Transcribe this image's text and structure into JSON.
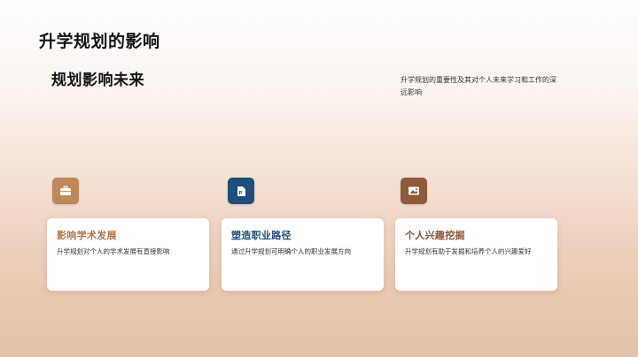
{
  "slide": {
    "title": "升学规划的影响",
    "subtitle": "规划影响未来",
    "description": "升学规划的重要性及其对个人未来学习和工作的深远影响",
    "cards": [
      {
        "title": "影响学术发展",
        "text": "升学规划对个人的学术发展有直接影响",
        "icon": "briefcase-icon",
        "title_color": "#b0764a",
        "icon_bg": "#c08859"
      },
      {
        "title": "塑造职业路径",
        "text": "通过升学规划可明确个人的职业发展方向",
        "icon": "document-icon",
        "title_color": "#1f4e7a",
        "icon_bg": "#1f4e7a"
      },
      {
        "title": "个人兴趣挖掘",
        "text": "升学规划有助于发掘和培养个人的兴趣爱好",
        "icon": "image-icon",
        "title_color": "#8a5634",
        "icon_bg": "#8f5a38"
      }
    ]
  }
}
